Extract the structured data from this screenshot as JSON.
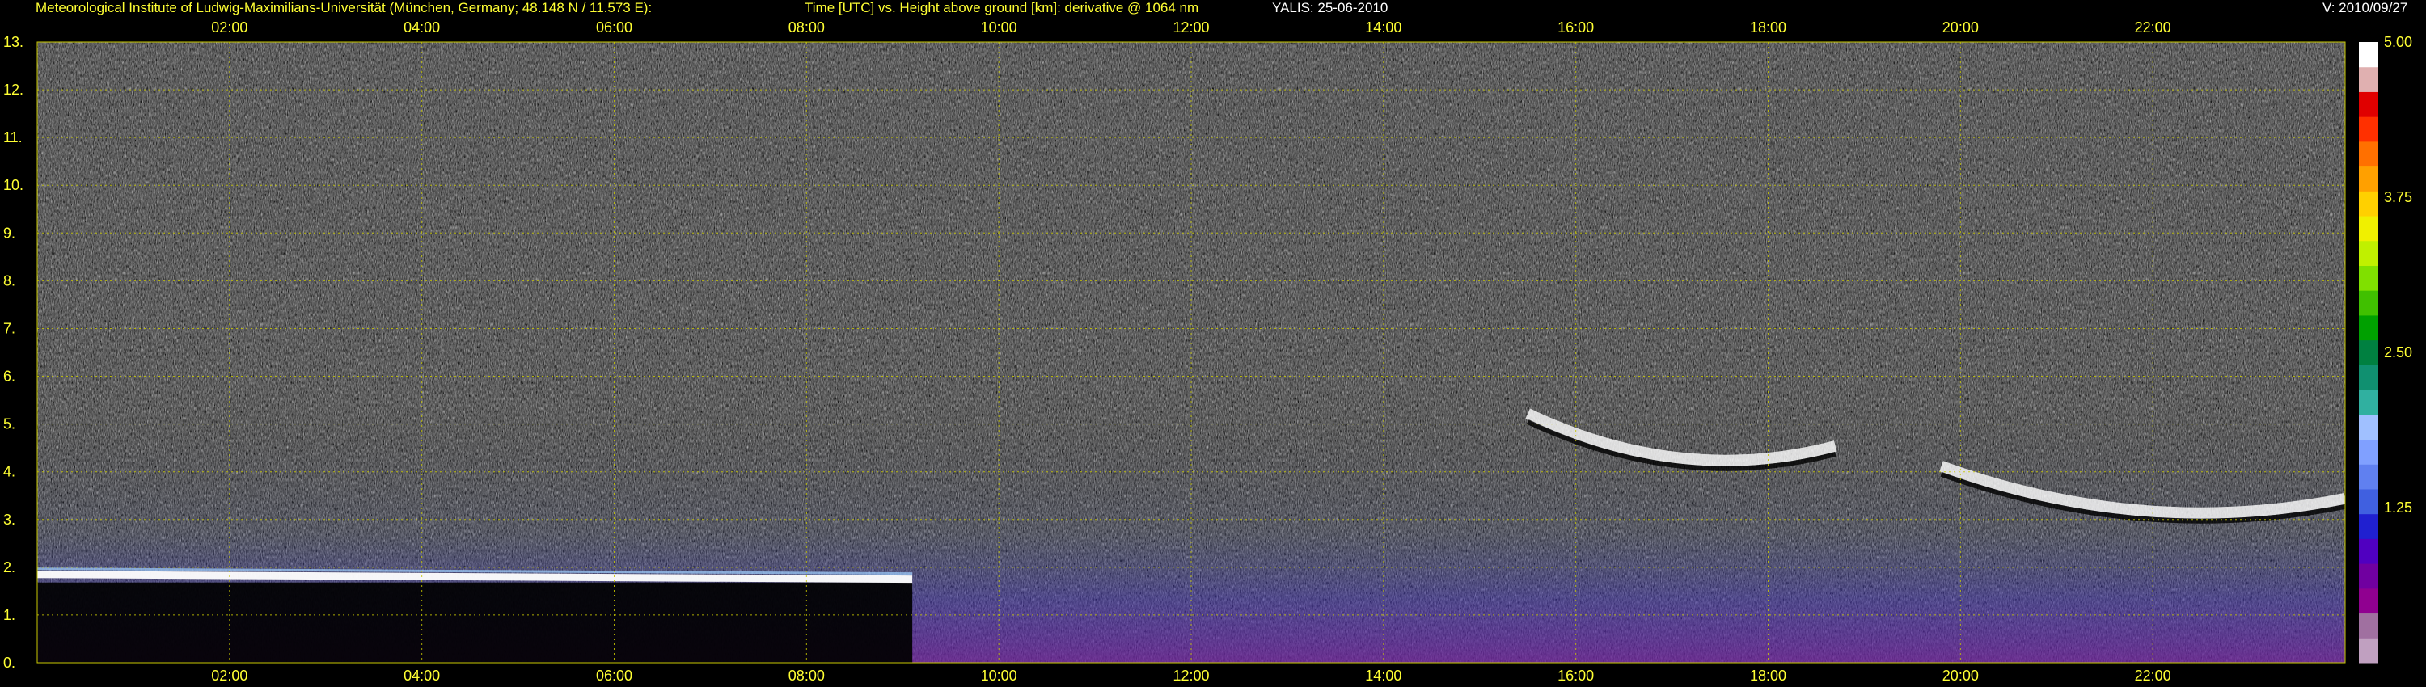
{
  "header": {
    "institute": "Meteorological Institute of Ludwig-Maximilians-Universität (München, Germany; 48.148 N / 11.573 E):",
    "plot_description": "Time [UTC] vs. Height above ground [km]: derivative @ 1064 nm",
    "instrument_date": "YALIS: 25-06-2010",
    "version": "V: 2010/09/27"
  },
  "colors": {
    "header_text": "#ffff33",
    "axis_text": "#ffff33",
    "grid": "#c8c800",
    "background": "#000000"
  },
  "chart_data": {
    "type": "heatmap",
    "title": "Time [UTC] vs. Height above ground [km]: derivative @ 1064 nm",
    "x_axis": {
      "unit": "UTC",
      "range_hours": [
        0,
        24
      ],
      "tick_labels": [
        "02:00",
        "04:00",
        "06:00",
        "08:00",
        "10:00",
        "12:00",
        "14:00",
        "16:00",
        "18:00",
        "20:00",
        "22:00"
      ],
      "tick_hours": [
        2,
        4,
        6,
        8,
        10,
        12,
        14,
        16,
        18,
        20,
        22
      ],
      "ticks_top_and_bottom": true
    },
    "y_axis": {
      "unit": "km",
      "range": [
        0,
        13
      ],
      "tick_labels": [
        "0.",
        "1.",
        "2.",
        "3.",
        "4.",
        "5.",
        "6.",
        "7.",
        "8.",
        "9.",
        "10.",
        "11.",
        "12.",
        "13."
      ],
      "tick_values": [
        0,
        1,
        2,
        3,
        4,
        5,
        6,
        7,
        8,
        9,
        10,
        11,
        12,
        13
      ]
    },
    "grid": true,
    "colorbar": {
      "range": [
        0,
        5
      ],
      "tick_labels": [
        "1.25",
        "2.50",
        "3.75",
        "5.00"
      ],
      "tick_values": [
        1.25,
        2.5,
        3.75,
        5.0
      ],
      "colors": [
        "#c0a0c0",
        "#a070a0",
        "#900090",
        "#7000a0",
        "#5000c0",
        "#2020d0",
        "#4060e0",
        "#6080f0",
        "#80a0ff",
        "#a0c0ff",
        "#30b0a0",
        "#109070",
        "#008040",
        "#00a000",
        "#40c000",
        "#80e000",
        "#c0f000",
        "#f0f000",
        "#ffd000",
        "#ffa000",
        "#ff7000",
        "#ff3000",
        "#e00000",
        "#e0b0b0",
        "#ffffff"
      ]
    },
    "features": [
      {
        "name": "boundary layer top",
        "t_start": 0.0,
        "t_end": 9.1,
        "h_start": 1.85,
        "h_end": 1.75
      },
      {
        "name": "cloud layer",
        "t_start": 15.5,
        "t_end": 18.7,
        "h": 4.2
      },
      {
        "name": "cloud layer",
        "t_start": 19.8,
        "t_end": 24.0,
        "h": 3.1
      }
    ]
  }
}
